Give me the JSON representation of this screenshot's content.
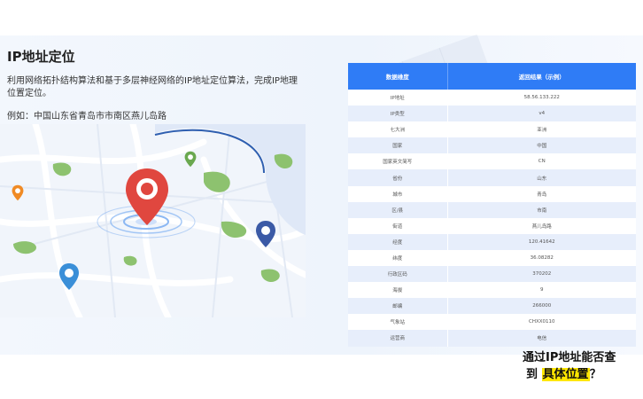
{
  "title": "IP地址定位",
  "description": "利用网络拓扑结构算法和基于多层神经网络的IP地址定位算法，完成IP地理位置定位。",
  "example": "例如：中国山东省青岛市市南区燕儿岛路",
  "table": {
    "headers": [
      "数据维度",
      "返回结果（示例）"
    ],
    "rows": [
      {
        "field": "IP地址",
        "value": "58.56.133.222"
      },
      {
        "field": "IP类型",
        "value": "v4"
      },
      {
        "field": "七大洲",
        "value": "亚洲"
      },
      {
        "field": "国家",
        "value": "中国"
      },
      {
        "field": "国家英文简写",
        "value": "CN"
      },
      {
        "field": "省份",
        "value": "山东"
      },
      {
        "field": "城市",
        "value": "青岛"
      },
      {
        "field": "区/县",
        "value": "市南"
      },
      {
        "field": "街道",
        "value": "燕儿岛路"
      },
      {
        "field": "经度",
        "value": "120.41642"
      },
      {
        "field": "纬度",
        "value": "36.08282"
      },
      {
        "field": "行政区码",
        "value": "370202"
      },
      {
        "field": "海拔",
        "value": "9"
      },
      {
        "field": "邮编",
        "value": "266000"
      },
      {
        "field": "气象站",
        "value": "CHXX0110"
      },
      {
        "field": "运营商",
        "value": "电信"
      }
    ]
  },
  "caption": {
    "line1": "通过IP地址能否查",
    "line2_prefix": "到",
    "line2_highlight": "具体位置",
    "line2_suffix": "？"
  },
  "colors": {
    "header_blue": "#2f7cf6",
    "row_alt": "#e7eefb",
    "pin_red": "#e0473f",
    "pin_navy": "#3b5aa6",
    "pin_blue": "#3a8fd8",
    "pin_green": "#6aa84f",
    "pin_orange": "#f08a24",
    "highlight": "#ffe600"
  }
}
